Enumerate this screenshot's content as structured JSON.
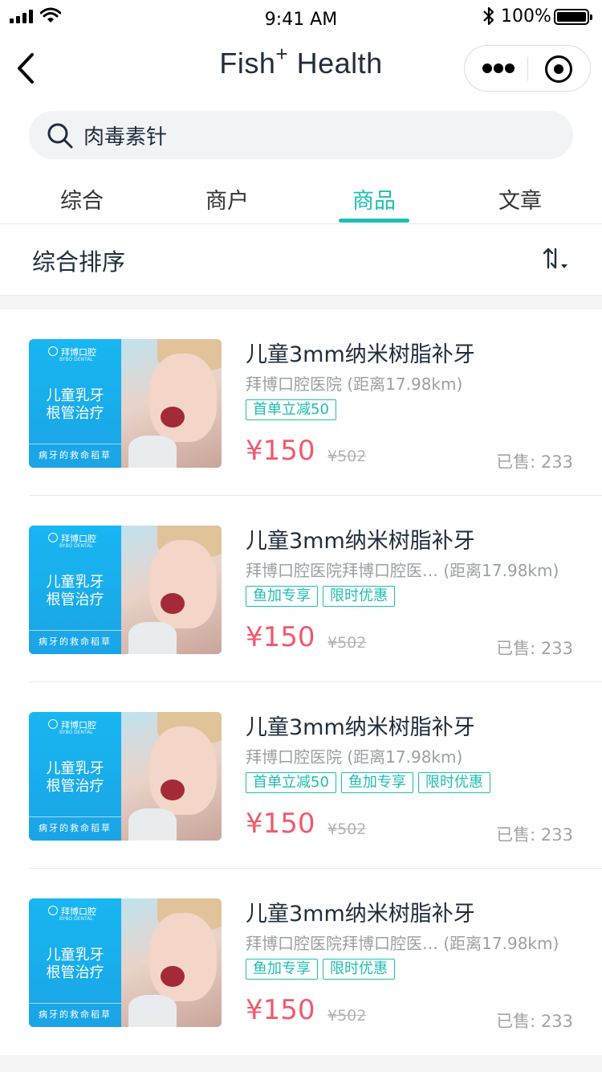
{
  "status": {
    "time": "9:41 AM",
    "battery": "100%"
  },
  "nav": {
    "title_main": "Fish",
    "title_sup": "+",
    "title_rest": " Health"
  },
  "search": {
    "value": "肉毒素针"
  },
  "tabs": [
    {
      "label": "综合"
    },
    {
      "label": "商户"
    },
    {
      "label": "商品",
      "active": true
    },
    {
      "label": "文章"
    }
  ],
  "sort": {
    "label": "综合排序"
  },
  "thumb": {
    "logo": "拜博口腔",
    "logo_sub": "BYBO DENTAL",
    "headline_1": "儿童乳牙",
    "headline_2": "根管治疗",
    "footer": "病牙的救命稻草"
  },
  "items": [
    {
      "name": "儿童3mm纳米树脂补牙",
      "shop": "拜博口腔医院 (距离17.98km)",
      "tags": [
        "首单立减50"
      ],
      "price": "¥150",
      "orig": "¥502",
      "sold": "已售: 233"
    },
    {
      "name": "儿童3mm纳米树脂补牙",
      "shop": "拜博口腔医院拜博口腔医… (距离17.98km)",
      "tags": [
        "鱼加专享",
        "限时优惠"
      ],
      "price": "¥150",
      "orig": "¥502",
      "sold": "已售: 233"
    },
    {
      "name": "儿童3mm纳米树脂补牙",
      "shop": "拜博口腔医院 (距离17.98km)",
      "tags": [
        "首单立减50",
        "鱼加专享",
        "限时优惠"
      ],
      "price": "¥150",
      "orig": "¥502",
      "sold": "已售: 233"
    },
    {
      "name": "儿童3mm纳米树脂补牙",
      "shop": "拜博口腔医院拜博口腔医… (距离17.98km)",
      "tags": [
        "鱼加专享",
        "限时优惠"
      ],
      "price": "¥150",
      "orig": "¥502",
      "sold": "已售: 233"
    }
  ],
  "colors": {
    "accent": "#1dbfb2",
    "price": "#f25a6c",
    "thumb_blue": "#18b6f2"
  },
  "icons": [
    "signal-icon",
    "wifi-icon",
    "bluetooth-icon",
    "battery-icon",
    "back-icon",
    "more-icon",
    "target-icon",
    "search-icon",
    "sort-icon"
  ]
}
